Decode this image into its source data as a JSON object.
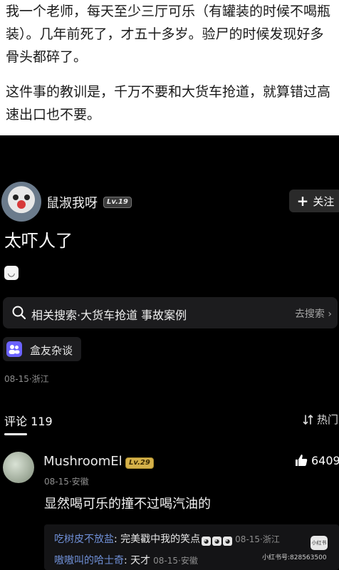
{
  "article": {
    "paragraph1": "我一个老师，每天至少三厅可乐（有罐装的时候不喝瓶装）。几年前死了，才五十多岁。验尸的时候发现好多骨头都碎了。",
    "paragraph2": "这件事的教训是，千万不要和大货车抢道，就算错过高速出口也不要。"
  },
  "post": {
    "username": "鼠淑我呀",
    "level": "Lv.19",
    "follow_label": "关注",
    "text": "太吓人了",
    "emoji": "😄"
  },
  "related_search": {
    "label": "相关搜索·大货车抢道 事故案例",
    "action": "去搜索"
  },
  "channel": {
    "label": "盒友杂谈"
  },
  "post_meta": {
    "date_location": "08-15·浙江"
  },
  "comments": {
    "title": "评论 119",
    "sort_label": "热门",
    "items": [
      {
        "username": "MushroomEl",
        "level": "Lv.29",
        "likes": "6409",
        "meta": "08-15·安徽",
        "text": "显然喝可乐的撞不过喝汽油的",
        "replies": [
          {
            "name": "吃树皮不放盐",
            "text": ": 完美戳中我的笑点",
            "time": "08-15·浙江"
          },
          {
            "name": "嗷嗷叫的哈士奇",
            "text": ": 天才",
            "time": "08-15·安徽"
          }
        ]
      }
    ]
  },
  "watermark": {
    "text": "小红书号:828563500",
    "logo": "小红书"
  },
  "colors": {
    "background": "#000000",
    "article_bg": "#ffffff",
    "reply_name": "#6f8fd6",
    "card_bg": "#1c1c1e"
  }
}
